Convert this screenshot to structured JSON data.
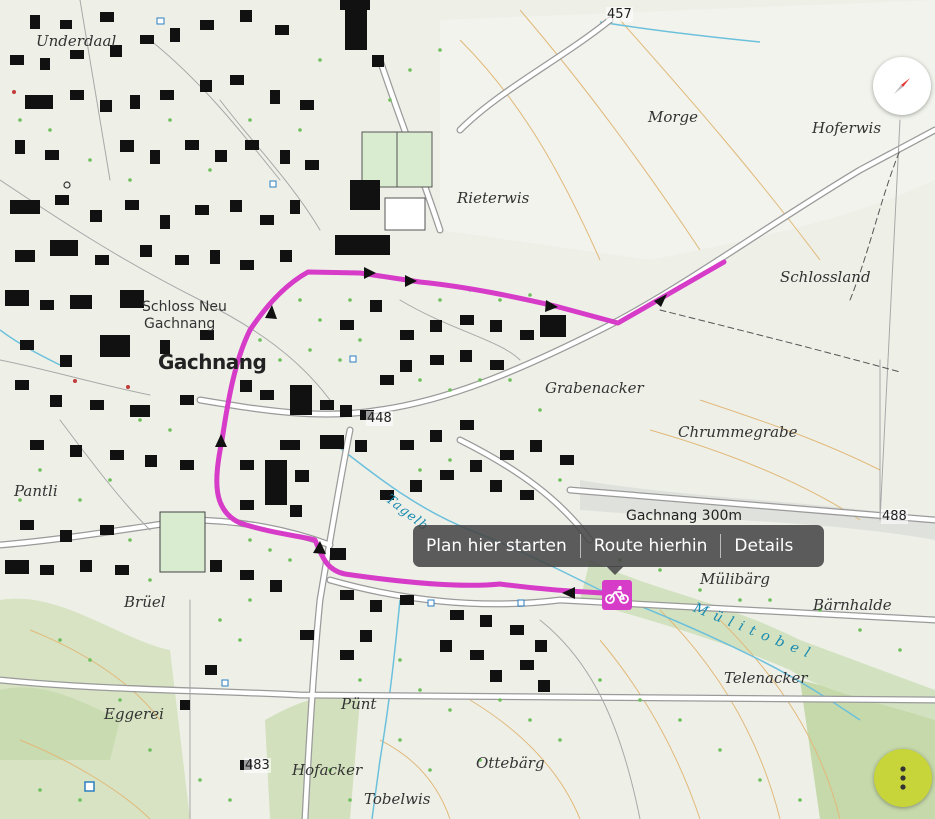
{
  "map": {
    "place_labels": {
      "underdaal": "Underdaal",
      "morge": "Morge",
      "hoferwis": "Hoferwis",
      "rieterwis": "Rieterwis",
      "schlossland": "Schlossland",
      "schloss_neu_line1": "Schloss Neu",
      "schloss_neu_line2": "Gachnang",
      "gachnang": "Gachnang",
      "grabenacker": "Grabenacker",
      "chrummegrabe": "Chrummegrabe",
      "pantli": "Pantli",
      "gachnang_300m": "Gachnang 300m",
      "muelibaerg": "Mülibärg",
      "baernhalde": "Bärnhalde",
      "brueel": "Brüel",
      "muelitobel": "Mülitobel",
      "telenacker": "Telenacker",
      "eggerei": "Eggerei",
      "puent": "Pünt",
      "hofacker": "Hofacker",
      "ottebaerg": "Ottebärg",
      "tobelwis": "Tobelwis",
      "tagelbach": "Tagelb"
    },
    "spot_heights": {
      "h457": "457",
      "h448": "448",
      "h488": "488",
      "h483": "483"
    },
    "colors": {
      "route": "#d63cc8",
      "water": "#6cc0dc",
      "forest": "#c9dbb0",
      "building": "#111111",
      "road": "#ffffff",
      "contour": "#e0b070"
    }
  },
  "popup": {
    "start_here": "Plan hier starten",
    "route_here": "Route hierhin",
    "details": "Details"
  },
  "icons": {
    "compass": "compass-icon",
    "bike": "bicycle-icon",
    "menu": "more-vertical-icon"
  }
}
